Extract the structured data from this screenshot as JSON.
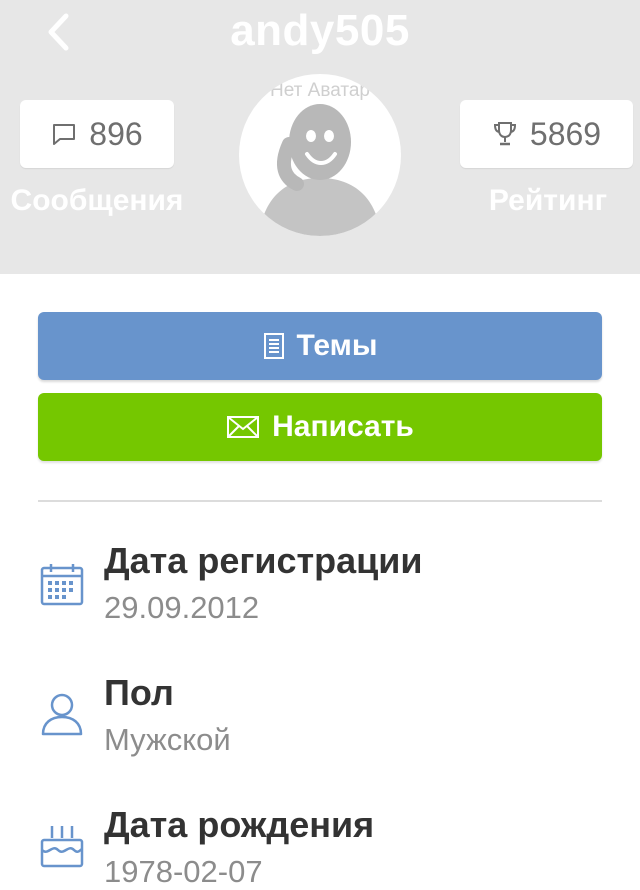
{
  "header": {
    "title": "andy505",
    "messages": {
      "count": "896",
      "label": "Сообщения",
      "icon": "speech-bubble-icon"
    },
    "rating": {
      "count": "5869",
      "label": "Рейтинг",
      "icon": "trophy-icon"
    },
    "avatar_text": "Нет Аватар"
  },
  "actions": {
    "topics_label": "Темы",
    "write_label": "Написать"
  },
  "info": [
    {
      "label": "Дата регистрации",
      "value": "29.09.2012",
      "icon": "calendar-icon"
    },
    {
      "label": "Пол",
      "value": "Мужской",
      "icon": "user-icon"
    },
    {
      "label": "Дата рождения",
      "value": "1978-02-07",
      "icon": "cake-icon"
    }
  ],
  "colors": {
    "header_bg": "#e7e7e7",
    "topics_button": "#6894cc",
    "write_button": "#75c700",
    "icon_blue": "#6894cc"
  }
}
